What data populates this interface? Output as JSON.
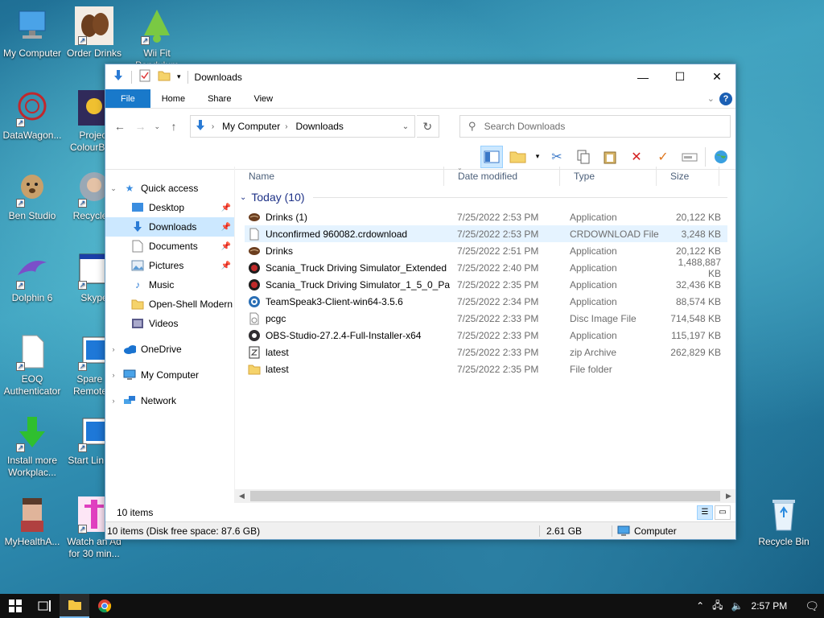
{
  "desktop": {
    "icons": [
      {
        "label": "My Computer"
      },
      {
        "label": "Order Drinks"
      },
      {
        "label": "Wii Fit Pendulum"
      },
      {
        "label": "DataWagon..."
      },
      {
        "label": "Project ColourBu..."
      },
      {
        "label": "Ben Studio"
      },
      {
        "label": "Recycle..."
      },
      {
        "label": "Dolphin 6"
      },
      {
        "label": "Skype"
      },
      {
        "label": "EOQ Authenticator"
      },
      {
        "label": "Spare S Remote..."
      },
      {
        "label": "Install more Workplac..."
      },
      {
        "label": "Start Lin OS"
      },
      {
        "label": "MyHealthA..."
      },
      {
        "label": "Watch an Ad for 30 min..."
      },
      {
        "label": "Recycle Bin"
      }
    ]
  },
  "window": {
    "title": "Downloads",
    "controls": {
      "minimize": "—",
      "maximize": "☐",
      "close": "✕"
    },
    "ribbon_tabs": [
      {
        "label": "File"
      },
      {
        "label": "Home"
      },
      {
        "label": "Share"
      },
      {
        "label": "View"
      }
    ],
    "address": {
      "crumbs": [
        "My Computer",
        "Downloads"
      ]
    },
    "search": {
      "placeholder": "Search Downloads"
    },
    "nav": {
      "quick_access": "Quick access",
      "quick_items": [
        {
          "label": "Desktop",
          "pinned": true
        },
        {
          "label": "Downloads",
          "pinned": true
        },
        {
          "label": "Documents",
          "pinned": true
        },
        {
          "label": "Pictures",
          "pinned": true
        },
        {
          "label": "Music",
          "pinned": false
        },
        {
          "label": "Open-Shell Modern",
          "pinned": false
        },
        {
          "label": "Videos",
          "pinned": false
        }
      ],
      "onedrive": "OneDrive",
      "mycomputer": "My Computer",
      "network": "Network"
    },
    "columns": {
      "name": "Name",
      "date": "Date modified",
      "type": "Type",
      "size": "Size"
    },
    "group": {
      "label": "Today (10)"
    },
    "files": [
      {
        "name": "Drinks (1)",
        "date": "7/25/2022 2:53 PM",
        "type": "Application",
        "size": "20,122 KB",
        "icon": "coffee-icon"
      },
      {
        "name": "Unconfirmed 960082.crdownload",
        "date": "7/25/2022 2:53 PM",
        "type": "CRDOWNLOAD File",
        "size": "3,248 KB",
        "icon": "blank-file-icon"
      },
      {
        "name": "Drinks",
        "date": "7/25/2022 2:51 PM",
        "type": "Application",
        "size": "20,122 KB",
        "icon": "coffee-icon"
      },
      {
        "name": "Scania_Truck Driving Simulator_Extended",
        "date": "7/25/2022 2:40 PM",
        "type": "Application",
        "size": "1,488,887 KB",
        "icon": "truck-icon"
      },
      {
        "name": "Scania_Truck Driving Simulator_1_5_0_Pa...",
        "date": "7/25/2022 2:35 PM",
        "type": "Application",
        "size": "32,436 KB",
        "icon": "truck-icon"
      },
      {
        "name": "TeamSpeak3-Client-win64-3.5.6",
        "date": "7/25/2022 2:34 PM",
        "type": "Application",
        "size": "88,574 KB",
        "icon": "teamspeak-icon"
      },
      {
        "name": "pcgc",
        "date": "7/25/2022 2:33 PM",
        "type": "Disc Image File",
        "size": "714,548 KB",
        "icon": "disc-image-icon"
      },
      {
        "name": "OBS-Studio-27.2.4-Full-Installer-x64",
        "date": "7/25/2022 2:33 PM",
        "type": "Application",
        "size": "115,197 KB",
        "icon": "obs-icon"
      },
      {
        "name": "latest",
        "date": "7/25/2022 2:33 PM",
        "type": "zip Archive",
        "size": "262,829 KB",
        "icon": "zip-icon"
      },
      {
        "name": "latest",
        "date": "7/25/2022 2:35 PM",
        "type": "File folder",
        "size": "",
        "icon": "folder-icon"
      }
    ],
    "status": {
      "item_count": "10 items",
      "disk": "10 items (Disk free space: 87.6 GB)",
      "size": "2.61 GB",
      "location": "Computer"
    }
  },
  "taskbar": {
    "time": "2:57 PM"
  },
  "colors": {
    "accent": "#1979ca",
    "selection": "#cce8ff",
    "group_header": "#1e3287"
  }
}
